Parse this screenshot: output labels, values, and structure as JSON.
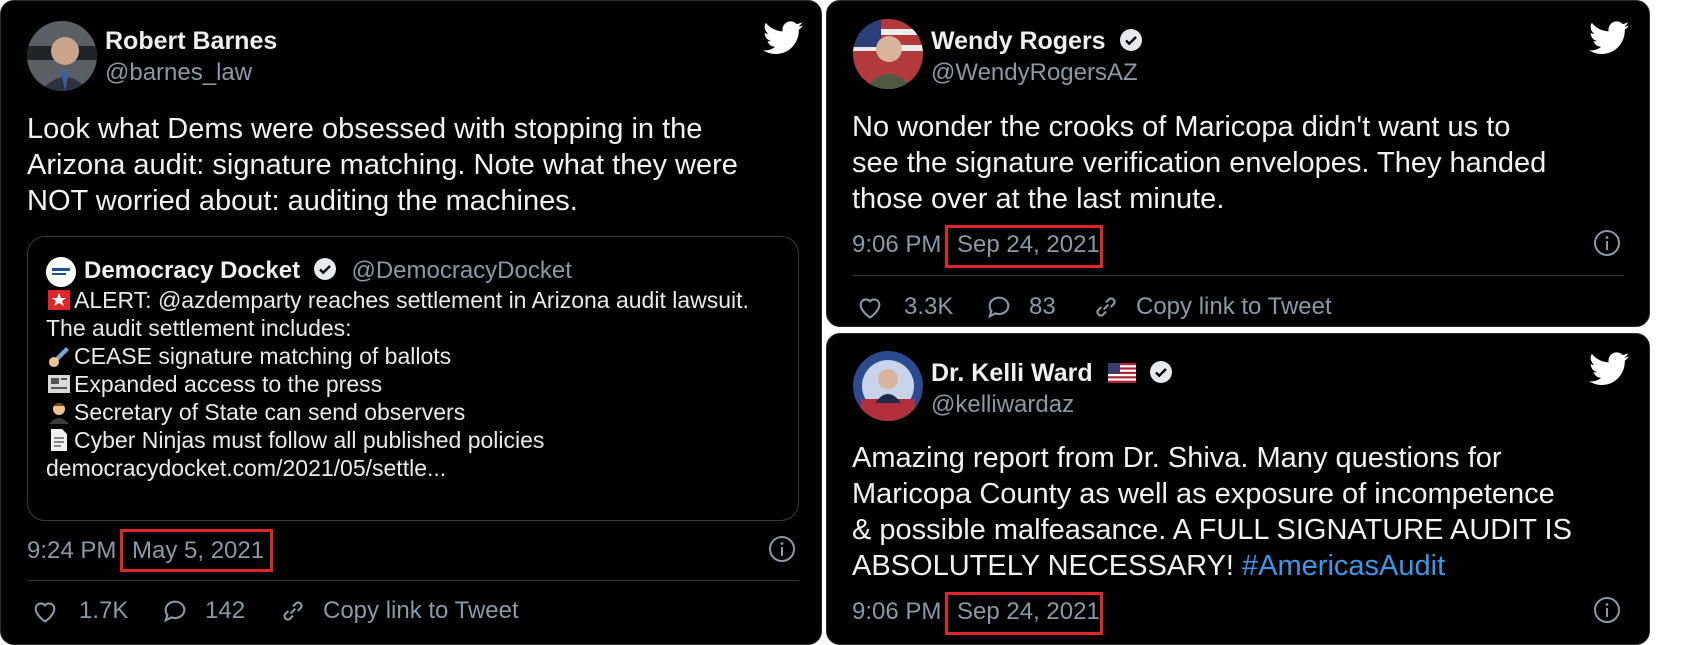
{
  "tweets": {
    "barnes": {
      "name": "Robert Barnes",
      "handle": "@barnes_law",
      "text_lines": [
        "Look what Dems were obsessed with stopping in the",
        "Arizona audit: signature matching. Note what they were",
        "NOT worried about: auditing the machines."
      ],
      "quote": {
        "name": "Democracy Docket",
        "handle": "@DemocracyDocket",
        "lines": [
          "ALERT: @azdemparty reaches settlement in Arizona audit lawsuit.",
          "The audit settlement includes:",
          "CEASE signature matching of ballots",
          "Expanded access to the press",
          "Secretary of State can send observers",
          "Cyber Ninjas must follow all published policies",
          "democracydocket.com/2021/05/settle..."
        ]
      },
      "time": "9:24 PM",
      "date": "May 5, 2021",
      "likes": "1.7K",
      "replies": "142",
      "copy_link": "Copy link to Tweet"
    },
    "rogers": {
      "name": "Wendy Rogers",
      "handle": "@WendyRogersAZ",
      "text_lines": [
        "No wonder the crooks of Maricopa didn't want us to",
        "see the signature verification envelopes. They handed",
        "those over at the last minute."
      ],
      "time": "9:06 PM",
      "date": "Sep 24, 2021",
      "likes": "3.3K",
      "replies": "83",
      "copy_link": "Copy link to Tweet"
    },
    "ward": {
      "name": "Dr. Kelli Ward",
      "handle": "@kelliwardaz",
      "text_lines": [
        "Amazing report from Dr. Shiva. Many questions for",
        "Maricopa County as well as exposure of incompetence",
        "& possible malfeasance. A FULL SIGNATURE AUDIT IS",
        "ABSOLUTELY NECESSARY!"
      ],
      "hashtag": "#AmericasAudit",
      "time": "9:06 PM",
      "date": "Sep 24, 2021"
    }
  },
  "colors": {
    "background": "#000000",
    "text": "#f2f2f2",
    "muted": "#8b98a5",
    "highlight_box": "#e0262b",
    "hashtag": "#3a98e8",
    "twitter_bird": "#ffffff"
  },
  "icons": [
    "twitter-bird-icon",
    "verified-badge-icon",
    "info-icon",
    "heart-icon",
    "reply-icon",
    "link-icon",
    "us-flag-icon"
  ]
}
